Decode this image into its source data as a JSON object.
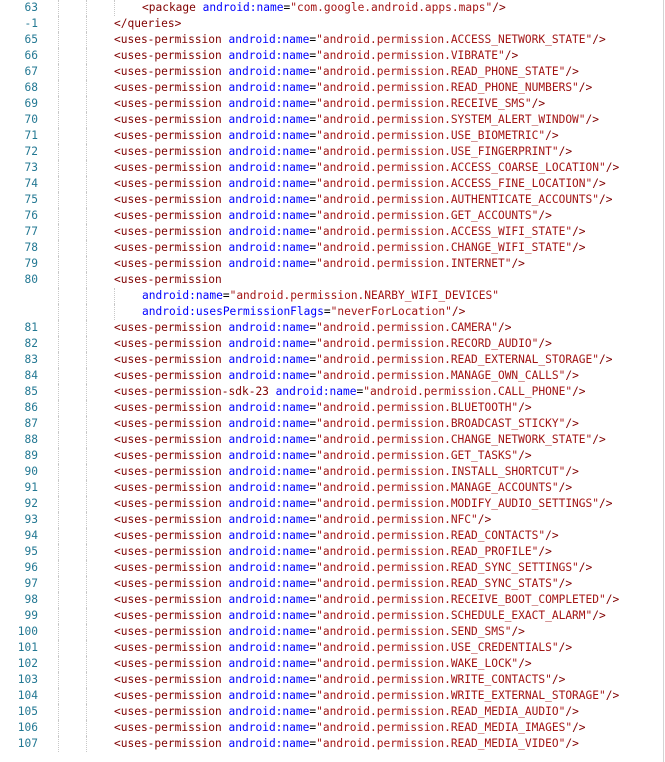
{
  "editor": {
    "lines": [
      {
        "num": "63",
        "indent": 3,
        "tag": "<package",
        "attr": "android:name",
        "val": "\"com.google.android.apps.maps\"",
        "close": "/>"
      },
      {
        "num": "-1",
        "indent": 2,
        "tag": "</queries>",
        "attr": "",
        "val": "",
        "close": ""
      },
      {
        "num": "65",
        "indent": 2,
        "tag": "<uses-permission",
        "attr": "android:name",
        "val": "\"android.permission.ACCESS_NETWORK_STATE\"",
        "close": "/>"
      },
      {
        "num": "66",
        "indent": 2,
        "tag": "<uses-permission",
        "attr": "android:name",
        "val": "\"android.permission.VIBRATE\"",
        "close": "/>"
      },
      {
        "num": "67",
        "indent": 2,
        "tag": "<uses-permission",
        "attr": "android:name",
        "val": "\"android.permission.READ_PHONE_STATE\"",
        "close": "/>"
      },
      {
        "num": "68",
        "indent": 2,
        "tag": "<uses-permission",
        "attr": "android:name",
        "val": "\"android.permission.READ_PHONE_NUMBERS\"",
        "close": "/>"
      },
      {
        "num": "69",
        "indent": 2,
        "tag": "<uses-permission",
        "attr": "android:name",
        "val": "\"android.permission.RECEIVE_SMS\"",
        "close": "/>"
      },
      {
        "num": "70",
        "indent": 2,
        "tag": "<uses-permission",
        "attr": "android:name",
        "val": "\"android.permission.SYSTEM_ALERT_WINDOW\"",
        "close": "/>"
      },
      {
        "num": "71",
        "indent": 2,
        "tag": "<uses-permission",
        "attr": "android:name",
        "val": "\"android.permission.USE_BIOMETRIC\"",
        "close": "/>"
      },
      {
        "num": "72",
        "indent": 2,
        "tag": "<uses-permission",
        "attr": "android:name",
        "val": "\"android.permission.USE_FINGERPRINT\"",
        "close": "/>"
      },
      {
        "num": "73",
        "indent": 2,
        "tag": "<uses-permission",
        "attr": "android:name",
        "val": "\"android.permission.ACCESS_COARSE_LOCATION\"",
        "close": "/>"
      },
      {
        "num": "74",
        "indent": 2,
        "tag": "<uses-permission",
        "attr": "android:name",
        "val": "\"android.permission.ACCESS_FINE_LOCATION\"",
        "close": "/>"
      },
      {
        "num": "75",
        "indent": 2,
        "tag": "<uses-permission",
        "attr": "android:name",
        "val": "\"android.permission.AUTHENTICATE_ACCOUNTS\"",
        "close": "/>"
      },
      {
        "num": "76",
        "indent": 2,
        "tag": "<uses-permission",
        "attr": "android:name",
        "val": "\"android.permission.GET_ACCOUNTS\"",
        "close": "/>"
      },
      {
        "num": "77",
        "indent": 2,
        "tag": "<uses-permission",
        "attr": "android:name",
        "val": "\"android.permission.ACCESS_WIFI_STATE\"",
        "close": "/>"
      },
      {
        "num": "78",
        "indent": 2,
        "tag": "<uses-permission",
        "attr": "android:name",
        "val": "\"android.permission.CHANGE_WIFI_STATE\"",
        "close": "/>"
      },
      {
        "num": "79",
        "indent": 2,
        "tag": "<uses-permission",
        "attr": "android:name",
        "val": "\"android.permission.INTERNET\"",
        "close": "/>"
      },
      {
        "num": "80",
        "indent": 2,
        "tag": "<uses-permission",
        "attr": "",
        "val": "",
        "close": ""
      },
      {
        "num": "",
        "indent": 3,
        "tag": "",
        "attr": "android:name",
        "val": "\"android.permission.NEARBY_WIFI_DEVICES\"",
        "close": ""
      },
      {
        "num": "",
        "indent": 3,
        "tag": "",
        "attr": "android:usesPermissionFlags",
        "val": "\"neverForLocation\"",
        "close": "/>"
      },
      {
        "num": "81",
        "indent": 2,
        "tag": "<uses-permission",
        "attr": "android:name",
        "val": "\"android.permission.CAMERA\"",
        "close": "/>"
      },
      {
        "num": "82",
        "indent": 2,
        "tag": "<uses-permission",
        "attr": "android:name",
        "val": "\"android.permission.RECORD_AUDIO\"",
        "close": "/>"
      },
      {
        "num": "83",
        "indent": 2,
        "tag": "<uses-permission",
        "attr": "android:name",
        "val": "\"android.permission.READ_EXTERNAL_STORAGE\"",
        "close": "/>"
      },
      {
        "num": "84",
        "indent": 2,
        "tag": "<uses-permission",
        "attr": "android:name",
        "val": "\"android.permission.MANAGE_OWN_CALLS\"",
        "close": "/>"
      },
      {
        "num": "85",
        "indent": 2,
        "tag": "<uses-permission-sdk-23",
        "attr": "android:name",
        "val": "\"android.permission.CALL_PHONE\"",
        "close": "/>"
      },
      {
        "num": "86",
        "indent": 2,
        "tag": "<uses-permission",
        "attr": "android:name",
        "val": "\"android.permission.BLUETOOTH\"",
        "close": "/>"
      },
      {
        "num": "87",
        "indent": 2,
        "tag": "<uses-permission",
        "attr": "android:name",
        "val": "\"android.permission.BROADCAST_STICKY\"",
        "close": "/>"
      },
      {
        "num": "88",
        "indent": 2,
        "tag": "<uses-permission",
        "attr": "android:name",
        "val": "\"android.permission.CHANGE_NETWORK_STATE\"",
        "close": "/>"
      },
      {
        "num": "89",
        "indent": 2,
        "tag": "<uses-permission",
        "attr": "android:name",
        "val": "\"android.permission.GET_TASKS\"",
        "close": "/>"
      },
      {
        "num": "90",
        "indent": 2,
        "tag": "<uses-permission",
        "attr": "android:name",
        "val": "\"android.permission.INSTALL_SHORTCUT\"",
        "close": "/>"
      },
      {
        "num": "91",
        "indent": 2,
        "tag": "<uses-permission",
        "attr": "android:name",
        "val": "\"android.permission.MANAGE_ACCOUNTS\"",
        "close": "/>"
      },
      {
        "num": "92",
        "indent": 2,
        "tag": "<uses-permission",
        "attr": "android:name",
        "val": "\"android.permission.MODIFY_AUDIO_SETTINGS\"",
        "close": "/>"
      },
      {
        "num": "93",
        "indent": 2,
        "tag": "<uses-permission",
        "attr": "android:name",
        "val": "\"android.permission.NFC\"",
        "close": "/>"
      },
      {
        "num": "94",
        "indent": 2,
        "tag": "<uses-permission",
        "attr": "android:name",
        "val": "\"android.permission.READ_CONTACTS\"",
        "close": "/>"
      },
      {
        "num": "95",
        "indent": 2,
        "tag": "<uses-permission",
        "attr": "android:name",
        "val": "\"android.permission.READ_PROFILE\"",
        "close": "/>"
      },
      {
        "num": "96",
        "indent": 2,
        "tag": "<uses-permission",
        "attr": "android:name",
        "val": "\"android.permission.READ_SYNC_SETTINGS\"",
        "close": "/>"
      },
      {
        "num": "97",
        "indent": 2,
        "tag": "<uses-permission",
        "attr": "android:name",
        "val": "\"android.permission.READ_SYNC_STATS\"",
        "close": "/>"
      },
      {
        "num": "98",
        "indent": 2,
        "tag": "<uses-permission",
        "attr": "android:name",
        "val": "\"android.permission.RECEIVE_BOOT_COMPLETED\"",
        "close": "/>"
      },
      {
        "num": "99",
        "indent": 2,
        "tag": "<uses-permission",
        "attr": "android:name",
        "val": "\"android.permission.SCHEDULE_EXACT_ALARM\"",
        "close": "/>"
      },
      {
        "num": "100",
        "indent": 2,
        "tag": "<uses-permission",
        "attr": "android:name",
        "val": "\"android.permission.SEND_SMS\"",
        "close": "/>"
      },
      {
        "num": "101",
        "indent": 2,
        "tag": "<uses-permission",
        "attr": "android:name",
        "val": "\"android.permission.USE_CREDENTIALS\"",
        "close": "/>"
      },
      {
        "num": "102",
        "indent": 2,
        "tag": "<uses-permission",
        "attr": "android:name",
        "val": "\"android.permission.WAKE_LOCK\"",
        "close": "/>"
      },
      {
        "num": "103",
        "indent": 2,
        "tag": "<uses-permission",
        "attr": "android:name",
        "val": "\"android.permission.WRITE_CONTACTS\"",
        "close": "/>"
      },
      {
        "num": "104",
        "indent": 2,
        "tag": "<uses-permission",
        "attr": "android:name",
        "val": "\"android.permission.WRITE_EXTERNAL_STORAGE\"",
        "close": "/>"
      },
      {
        "num": "105",
        "indent": 2,
        "tag": "<uses-permission",
        "attr": "android:name",
        "val": "\"android.permission.READ_MEDIA_AUDIO\"",
        "close": "/>"
      },
      {
        "num": "106",
        "indent": 2,
        "tag": "<uses-permission",
        "attr": "android:name",
        "val": "\"android.permission.READ_MEDIA_IMAGES\"",
        "close": "/>"
      },
      {
        "num": "107",
        "indent": 2,
        "tag": "<uses-permission",
        "attr": "android:name",
        "val": "\"android.permission.READ_MEDIA_VIDEO\"",
        "close": "/>"
      }
    ],
    "colors": {
      "line_number": "#237893",
      "tag": "#800000",
      "attribute": "#0000ff",
      "value": "#a31515"
    }
  }
}
